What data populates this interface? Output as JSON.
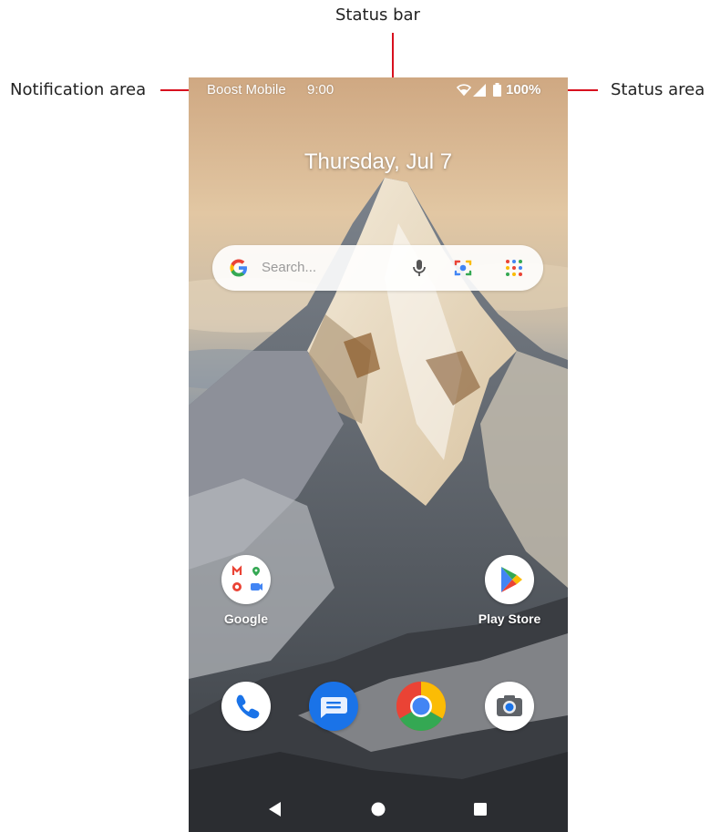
{
  "callouts": {
    "status_bar": "Status bar",
    "notification_area": "Notification area",
    "status_area": "Status area"
  },
  "status_bar": {
    "carrier": "Boost Mobile",
    "time": "9:00",
    "battery": "100%",
    "icons": [
      "wifi-icon",
      "cell-signal-icon",
      "battery-icon"
    ]
  },
  "home": {
    "date": "Thursday, Jul 7",
    "search": {
      "placeholder": "Search...",
      "icons": [
        "google-g-icon",
        "microphone-icon",
        "lens-camera-icon",
        "app-grid-icon"
      ]
    },
    "apps": [
      {
        "label": "Google",
        "icon": "google-folder-icon"
      },
      {
        "label": "Play Store",
        "icon": "play-store-icon"
      }
    ],
    "dock": [
      "phone-icon",
      "messages-icon",
      "chrome-icon",
      "camera-icon"
    ]
  },
  "navbar": [
    "back-icon",
    "home-icon",
    "recents-icon"
  ],
  "colors": {
    "callout_line": "#d8101e",
    "google_blue": "#4285F4",
    "google_red": "#EA4335",
    "google_yellow": "#FBBC05",
    "google_green": "#34A853"
  }
}
